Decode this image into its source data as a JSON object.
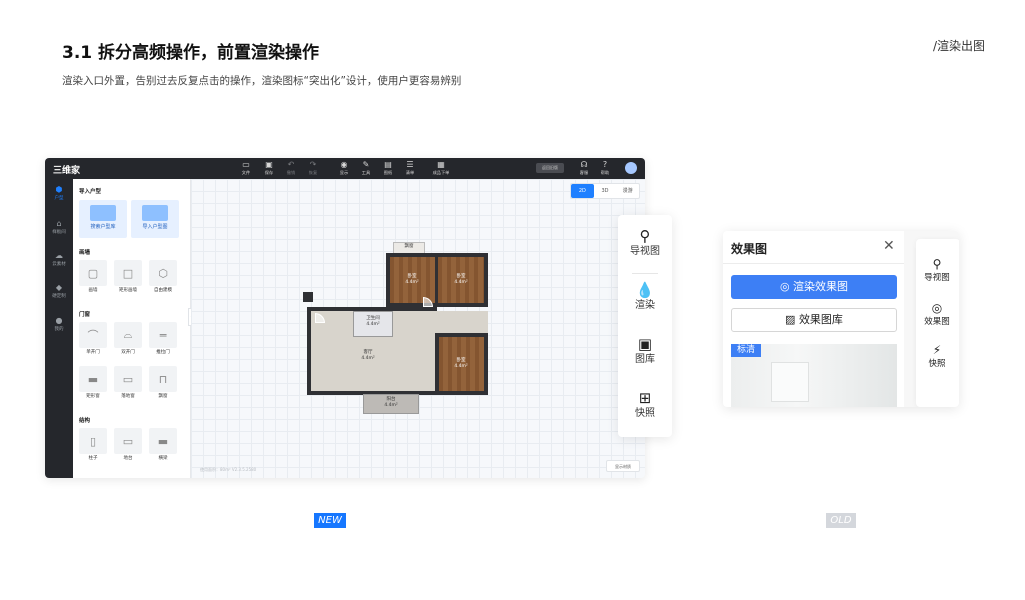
{
  "header": {
    "title": "3.1 拆分高频操作，前置渲染操作",
    "subtitle": "渲染入口外置，告别过去反复点击的操作，渲染图标“突出化”设计，使用户更容易辨别",
    "breadcrumb": "/渲染出图"
  },
  "new_app": {
    "logo": "三维家",
    "toolbar": [
      {
        "label": "文件",
        "icon": "file-icon"
      },
      {
        "label": "保存",
        "icon": "save-icon"
      },
      {
        "label": "撤销",
        "icon": "undo-icon"
      },
      {
        "label": "恢复",
        "icon": "redo-icon"
      },
      {
        "label": "显示",
        "icon": "eye-icon"
      },
      {
        "label": "工具",
        "icon": "tool-icon"
      },
      {
        "label": "图纸",
        "icon": "drawing-icon"
      },
      {
        "label": "清单",
        "icon": "list-icon"
      },
      {
        "label": "成品下单",
        "icon": "order-icon"
      }
    ],
    "top_pill": "返回旧版",
    "top_right": [
      {
        "label": "客服",
        "icon": "headset-icon"
      },
      {
        "label": "帮助",
        "icon": "help-icon"
      }
    ],
    "left_nav": [
      {
        "label": "户型",
        "icon": "cube-icon",
        "active": true
      },
      {
        "label": "样板间",
        "icon": "room-icon",
        "active": false
      },
      {
        "label": "云素材",
        "icon": "cloud-icon",
        "active": false
      },
      {
        "label": "硬定制",
        "icon": "custom-icon",
        "active": false
      },
      {
        "label": "我的",
        "icon": "user-icon",
        "active": false
      }
    ],
    "panel": {
      "import_title": "导入户型",
      "import_items": [
        "搜索户型库",
        "导入户型图"
      ],
      "wall_title": "画墙",
      "wall_items": [
        "画墙",
        "矩形画墙",
        "自由建模"
      ],
      "door_title": "门窗",
      "door_items_row1": [
        "单开门",
        "双开门",
        "推拉门"
      ],
      "door_items_row2": [
        "矩形窗",
        "落地窗",
        "飘窗"
      ],
      "struct_title": "结构",
      "struct_items": [
        "柱子",
        "地台",
        "横梁"
      ]
    },
    "view_toggle": [
      "2D",
      "3D",
      "漫游"
    ],
    "status_left": "使用面积：80m²    V2.3.5.2580",
    "status_right": "显示材质",
    "rooms": {
      "bay": "飘窗",
      "bedroom1": "卧室\n4.4m²",
      "bedroom2": "卧室\n4.4m²",
      "bedroom3": "卧室\n4.4m²",
      "bath": "卫生间\n4.4m²",
      "living": "客厅\n4.4m²",
      "balcony": "阳台\n4.4m²"
    }
  },
  "new_toolbar": {
    "items": [
      {
        "label": "导视图",
        "icon": "map-pin-icon"
      },
      {
        "label": "渲染",
        "icon": "droplet-icon"
      },
      {
        "label": "图库",
        "icon": "gallery-icon"
      },
      {
        "label": "快照",
        "icon": "snapshot-icon"
      }
    ]
  },
  "old_panel": {
    "title": "效果图",
    "close": "✕",
    "primary_button": "渲染效果图",
    "secondary_button": "效果图库",
    "badge": "标清",
    "side": [
      {
        "label": "导视图",
        "icon": "map-pin-icon"
      },
      {
        "label": "效果图",
        "icon": "camera-icon"
      },
      {
        "label": "快照",
        "icon": "snapshot-icon"
      }
    ]
  },
  "tags": {
    "new": "NEW",
    "old": "OLD"
  },
  "colors": {
    "accent": "#1677ff",
    "old_accent": "#3d7ff5",
    "topbar": "#25272c",
    "wood": "#8b5b34"
  }
}
